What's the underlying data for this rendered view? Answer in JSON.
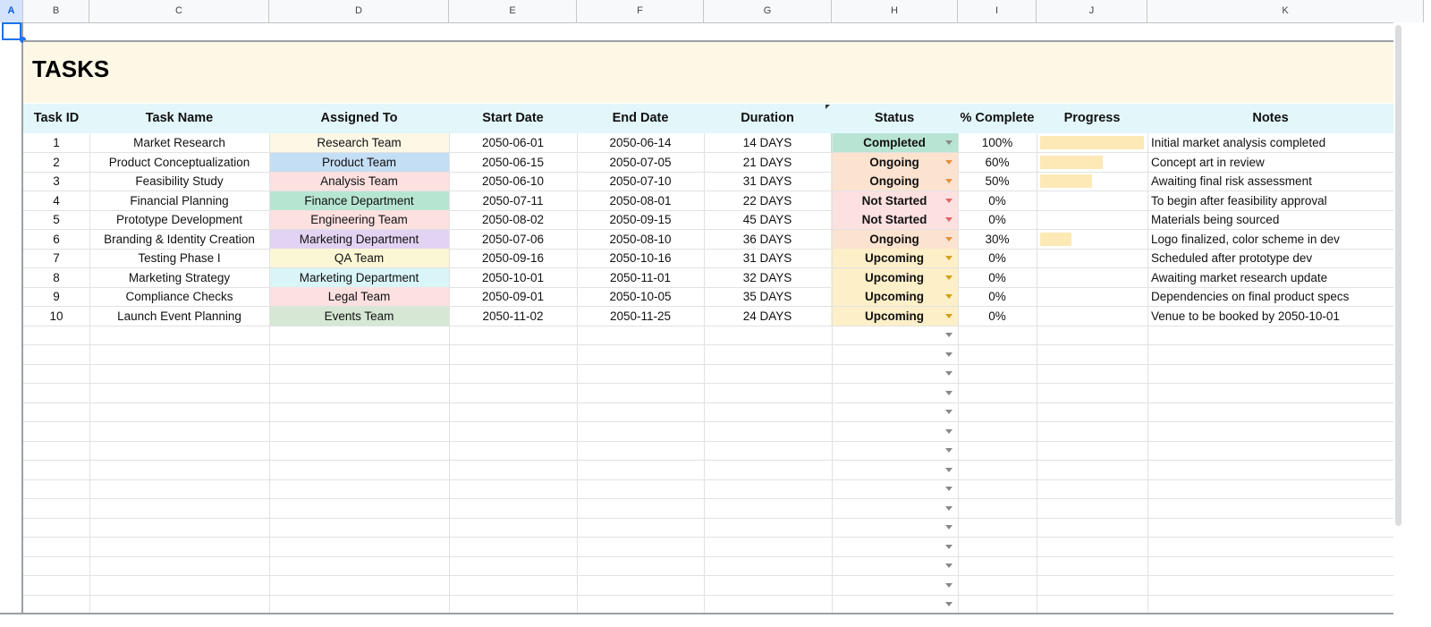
{
  "columns": [
    "A",
    "B",
    "C",
    "D",
    "E",
    "F",
    "G",
    "H",
    "I",
    "J",
    "K"
  ],
  "title": "TASKS",
  "headers": {
    "task_id": "Task ID",
    "task_name": "Task Name",
    "assigned_to": "Assigned To",
    "start_date": "Start Date",
    "end_date": "End Date",
    "duration": "Duration",
    "status": "Status",
    "pct_complete": "% Complete",
    "progress": "Progress",
    "notes": "Notes"
  },
  "rows": [
    {
      "id": "1",
      "name": "Market Research",
      "team": "Research Team",
      "team_color": "#fdf7e6",
      "start": "2050-06-01",
      "end": "2050-06-14",
      "duration": "14 DAYS",
      "status": "Completed",
      "status_color": "#b7e4d3",
      "arrow_color": "#888888",
      "pct": "100%",
      "progress": 1.0,
      "notes": "Initial market analysis completed"
    },
    {
      "id": "2",
      "name": "Product Conceptualization",
      "team": "Product Team",
      "team_color": "#c4def5",
      "start": "2050-06-15",
      "end": "2050-07-05",
      "duration": "21 DAYS",
      "status": "Ongoing",
      "status_color": "#fce3d0",
      "arrow_color": "#e69138",
      "pct": "60%",
      "progress": 0.6,
      "notes": "Concept art in review"
    },
    {
      "id": "3",
      "name": "Feasibility Study",
      "team": "Analysis Team",
      "team_color": "#fde0e0",
      "start": "2050-06-10",
      "end": "2050-07-10",
      "duration": "31 DAYS",
      "status": "Ongoing",
      "status_color": "#fce3d0",
      "arrow_color": "#e69138",
      "pct": "50%",
      "progress": 0.5,
      "notes": "Awaiting final risk assessment"
    },
    {
      "id": "4",
      "name": "Financial Planning",
      "team": "Finance Department",
      "team_color": "#b6e6d2",
      "start": "2050-07-11",
      "end": "2050-08-01",
      "duration": "22 DAYS",
      "status": "Not Started",
      "status_color": "#fde0e0",
      "arrow_color": "#e06666",
      "pct": "0%",
      "progress": 0,
      "notes": "To begin after feasibility approval"
    },
    {
      "id": "5",
      "name": "Prototype Development",
      "team": "Engineering Team",
      "team_color": "#fde0e0",
      "start": "2050-08-02",
      "end": "2050-09-15",
      "duration": "45 DAYS",
      "status": "Not Started",
      "status_color": "#fde0e0",
      "arrow_color": "#e06666",
      "pct": "0%",
      "progress": 0,
      "notes": "Materials being sourced"
    },
    {
      "id": "6",
      "name": "Branding & Identity Creation",
      "team": "Marketing Department",
      "team_color": "#e3d3f3",
      "start": "2050-07-06",
      "end": "2050-08-10",
      "duration": "36 DAYS",
      "status": "Ongoing",
      "status_color": "#fce3d0",
      "arrow_color": "#e69138",
      "pct": "30%",
      "progress": 0.3,
      "notes": "Logo finalized, color scheme in dev"
    },
    {
      "id": "7",
      "name": "Testing Phase I",
      "team": "QA Team",
      "team_color": "#fbf7d5",
      "start": "2050-09-16",
      "end": "2050-10-16",
      "duration": "31 DAYS",
      "status": "Upcoming",
      "status_color": "#fdefc8",
      "arrow_color": "#d4a017",
      "pct": "0%",
      "progress": 0,
      "notes": "Scheduled after prototype dev"
    },
    {
      "id": "8",
      "name": "Marketing Strategy",
      "team": "Marketing Department",
      "team_color": "#d9f5f7",
      "start": "2050-10-01",
      "end": "2050-11-01",
      "duration": "32 DAYS",
      "status": "Upcoming",
      "status_color": "#fdefc8",
      "arrow_color": "#d4a017",
      "pct": "0%",
      "progress": 0,
      "notes": "Awaiting market research update"
    },
    {
      "id": "9",
      "name": "Compliance Checks",
      "team": "Legal Team",
      "team_color": "#fde0e0",
      "start": "2050-09-01",
      "end": "2050-10-05",
      "duration": "35 DAYS",
      "status": "Upcoming",
      "status_color": "#fdefc8",
      "arrow_color": "#d4a017",
      "pct": "0%",
      "progress": 0,
      "notes": "Dependencies on final product specs"
    },
    {
      "id": "10",
      "name": "Launch Event Planning",
      "team": "Events Team",
      "team_color": "#d6e8d4",
      "start": "2050-11-02",
      "end": "2050-11-25",
      "duration": "24 DAYS",
      "status": "Upcoming",
      "status_color": "#fdefc8",
      "arrow_color": "#d4a017",
      "pct": "0%",
      "progress": 0,
      "notes": "Venue to be booked by 2050-10-01"
    }
  ],
  "empty_rows": 15
}
